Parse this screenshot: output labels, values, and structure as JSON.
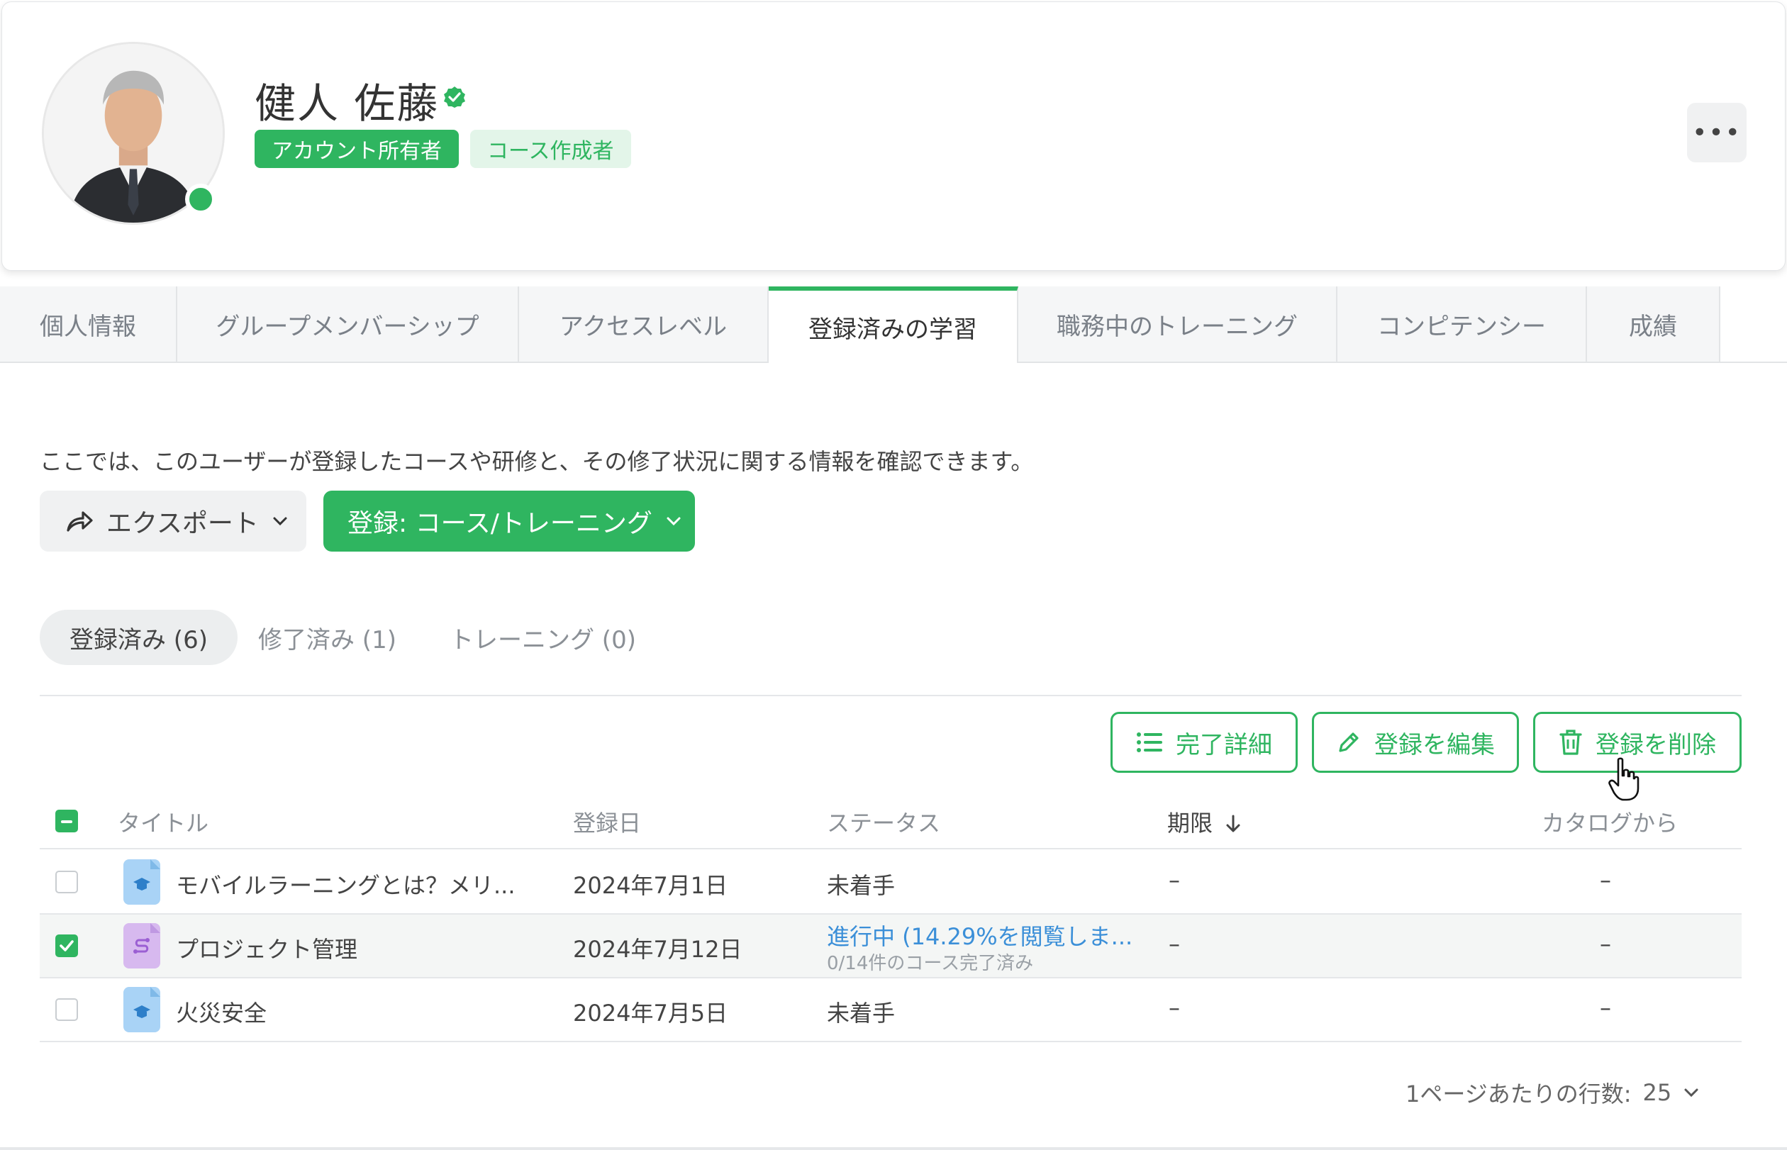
{
  "profile": {
    "name": "健人 佐藤",
    "badges": [
      "アカウント所有者",
      "コース作成者"
    ],
    "more_label": "•••"
  },
  "tabs": [
    {
      "label": "個人情報"
    },
    {
      "label": "グループメンバーシップ"
    },
    {
      "label": "アクセスレベル"
    },
    {
      "label": "登録済みの学習"
    },
    {
      "label": "職務中のトレーニング"
    },
    {
      "label": "コンピテンシー"
    },
    {
      "label": "成績"
    }
  ],
  "description": "ここでは、このユーザーが登録したコースや研修と、その修了状況に関する情報を確認できます。",
  "actions": {
    "export_label": "エクスポート",
    "enroll_label": "登録: コース/トレーニング"
  },
  "subtabs": [
    {
      "label": "登録済み (6)"
    },
    {
      "label": "修了済み (1)"
    },
    {
      "label": "トレーニング (0)"
    }
  ],
  "toolbar": {
    "completion_details": "完了詳細",
    "edit_enrollment": "登録を編集",
    "delete_enrollment": "登録を削除"
  },
  "table": {
    "columns": {
      "title": "タイトル",
      "enrolled": "登録日",
      "status": "ステータス",
      "due": "期限",
      "catalog": "カタログから"
    },
    "rows": [
      {
        "title": "モバイルラーニングとは？メリ...",
        "enrolled": "2024年7月1日",
        "status": "未着手",
        "status_sub": "",
        "due": "–",
        "catalog": "–",
        "checked": false,
        "icon": "course-icon"
      },
      {
        "title": "プロジェクト管理",
        "enrolled": "2024年7月12日",
        "status": "進行中 (14.29%を閲覧しま...",
        "status_sub": "0/14件のコース完了済み",
        "due": "–",
        "catalog": "–",
        "checked": true,
        "icon": "learning-path-icon"
      },
      {
        "title": "火災安全",
        "enrolled": "2024年7月5日",
        "status": "未着手",
        "status_sub": "",
        "due": "–",
        "catalog": "–",
        "checked": false,
        "icon": "course-icon"
      }
    ]
  },
  "pagination": {
    "rows_per_page_label": "1ページあたりの行数:",
    "rows_per_page_value": "25"
  },
  "colors": {
    "brand": "#2fb560",
    "brand_soft": "#e3f5e9",
    "link": "#3b8fd8"
  }
}
